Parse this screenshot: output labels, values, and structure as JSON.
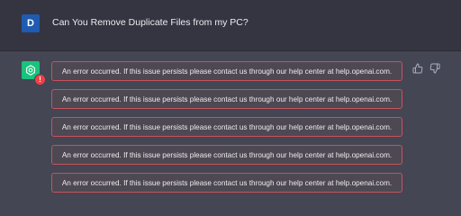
{
  "user": {
    "avatar_letter": "D",
    "message": "Can You Remove Duplicate Files from my PC?"
  },
  "assistant": {
    "error_badge": "!",
    "errors": [
      "An error occurred. If this issue persists please contact us through our help center at help.openai.com.",
      "An error occurred. If this issue persists please contact us through our help center at help.openai.com.",
      "An error occurred. If this issue persists please contact us through our help center at help.openai.com.",
      "An error occurred. If this issue persists please contact us through our help center at help.openai.com.",
      "An error occurred. If this issue persists please contact us through our help center at help.openai.com."
    ],
    "feedback_icons": [
      "thumbs-up-icon",
      "thumbs-down-icon"
    ]
  },
  "colors": {
    "user_bg": "#343541",
    "assistant_bg": "#444654",
    "error_border": "#c8525b",
    "bot_avatar": "#19c37d",
    "user_avatar": "#1f5bb0"
  }
}
